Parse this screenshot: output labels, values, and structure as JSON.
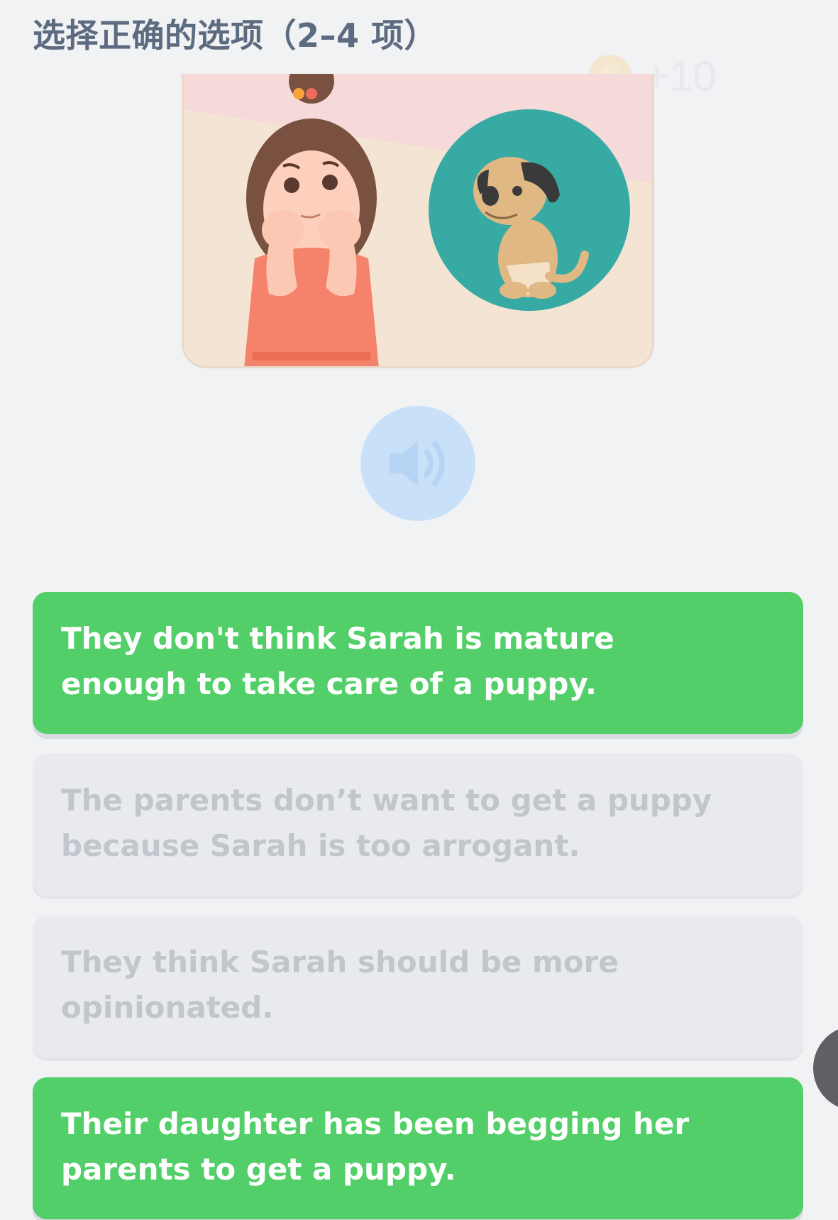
{
  "header": {
    "title": "选择正确的选项（2–4 项）",
    "reward_text": "+10",
    "reward_icon": "coin-icon"
  },
  "illustration": {
    "icon": "girl-and-puppy-illustration"
  },
  "audio": {
    "icon": "speaker-icon",
    "color": "#c9e1f8"
  },
  "options": [
    {
      "text": "They don't think Sarah is mature enough to take care of a puppy.",
      "state": "selected"
    },
    {
      "text": "The parents don’t want to get a puppy because Sarah is too arrogant.",
      "state": "disabled"
    },
    {
      "text": "They think Sarah should be more opinionated.",
      "state": "disabled"
    },
    {
      "text": "Their daughter has been begging her parents to get a puppy.",
      "state": "selected"
    }
  ],
  "colors": {
    "selected_bg": "#53cf69",
    "disabled_bg": "#e9eaed",
    "title": "#5d6b80"
  }
}
